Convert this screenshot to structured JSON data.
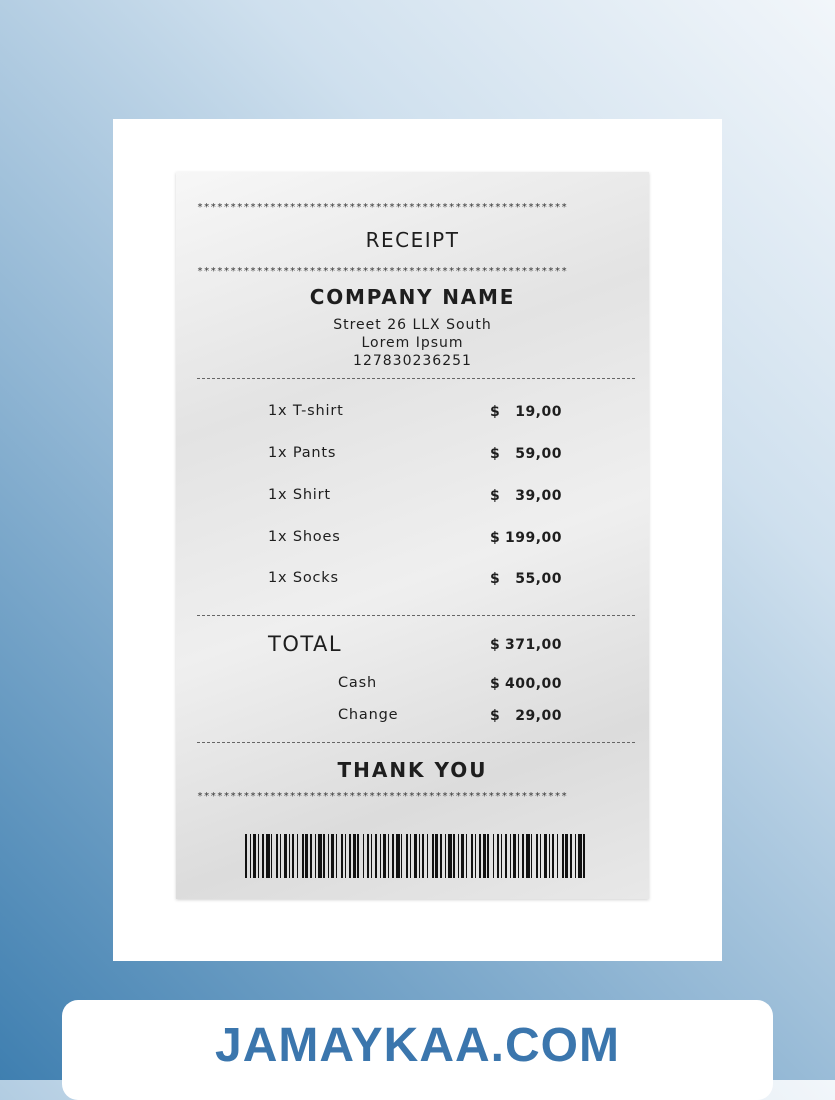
{
  "receipt": {
    "stars": "********************************************************",
    "title": "RECEIPT",
    "company": "COMPANY NAME",
    "address": [
      "Street 26 LLX South",
      "Lorem Ipsum",
      "127830236251"
    ],
    "items": [
      {
        "name": "1x T-shirt",
        "currency": "$",
        "amount": "19,00"
      },
      {
        "name": "1x Pants",
        "currency": "$",
        "amount": "59,00"
      },
      {
        "name": "1x Shirt",
        "currency": "$",
        "amount": "39,00"
      },
      {
        "name": "1x Shoes",
        "currency": "$",
        "amount": "199,00"
      },
      {
        "name": "1x Socks",
        "currency": "$",
        "amount": "55,00"
      }
    ],
    "total": {
      "label": "TOTAL",
      "currency": "$",
      "amount": "371,00"
    },
    "cash": {
      "label": "Cash",
      "currency": "$",
      "amount": "400,00"
    },
    "change": {
      "label": "Change",
      "currency": "$",
      "amount": "29,00"
    },
    "thanks": "THANK YOU"
  },
  "footer": {
    "brand": "JAMAYKAA.COM"
  }
}
